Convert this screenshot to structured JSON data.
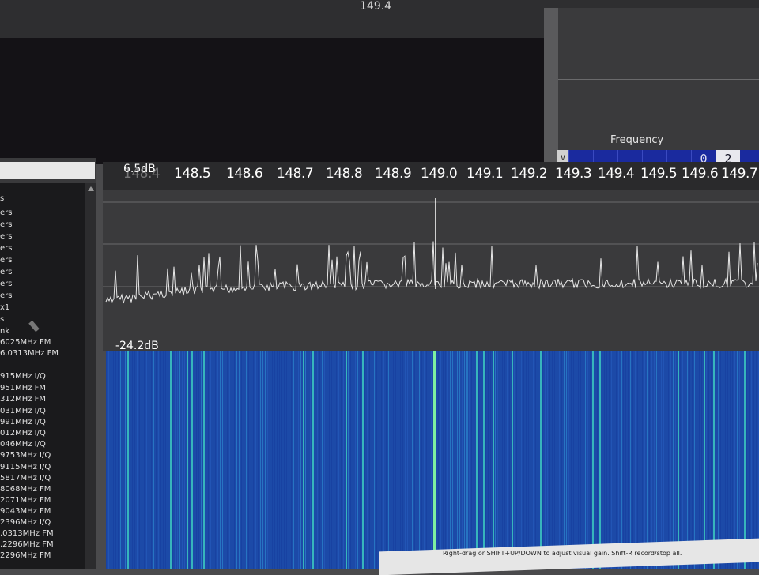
{
  "top": {
    "frequency_label": "149.4"
  },
  "frequency_panel": {
    "label": "Frequency",
    "v_label": "V",
    "digits": [
      "",
      "",
      "",
      "",
      "",
      "0",
      "2"
    ]
  },
  "spectrum": {
    "db_max": "6.5dB",
    "db_min": "-24.2dB",
    "axis_ticks": [
      "148.4",
      "148.5",
      "148.6",
      "148.7",
      "148.8",
      "148.9",
      "149.0",
      "149.1",
      "149.2",
      "149.3",
      "149.4",
      "149.5",
      "149.6",
      "149.7"
    ]
  },
  "sidebar": {
    "items": [
      "s",
      "ers",
      "ers",
      "ers",
      "ers",
      "ers",
      "ers",
      "ers",
      "ers",
      "x1",
      "s",
      "nk",
      "6025MHz FM",
      "6.0313MHz FM",
      "",
      "915MHz I/Q",
      "951MHz FM",
      "312MHz FM",
      "031MHz I/Q",
      "991MHz I/Q",
      "012MHz I/Q",
      "046MHz I/Q",
      "9753MHz I/Q",
      "9115MHz I/Q",
      "5817MHz I/Q",
      "8068MHz FM",
      "2071MHz FM",
      "9043MHz FM",
      "2396MHz I/Q",
      ".0313MHz FM",
      ".2296MHz FM",
      "2296MHz FM"
    ]
  },
  "status_bar": {
    "text": "Right-drag or SHIFT+UP/DOWN to adjust visual gain. Shift-R record/stop all."
  },
  "colors": {
    "waterfall_bg": "#1c4aa8",
    "trace": "#e8e8e8",
    "background": "#4a4a4c"
  }
}
